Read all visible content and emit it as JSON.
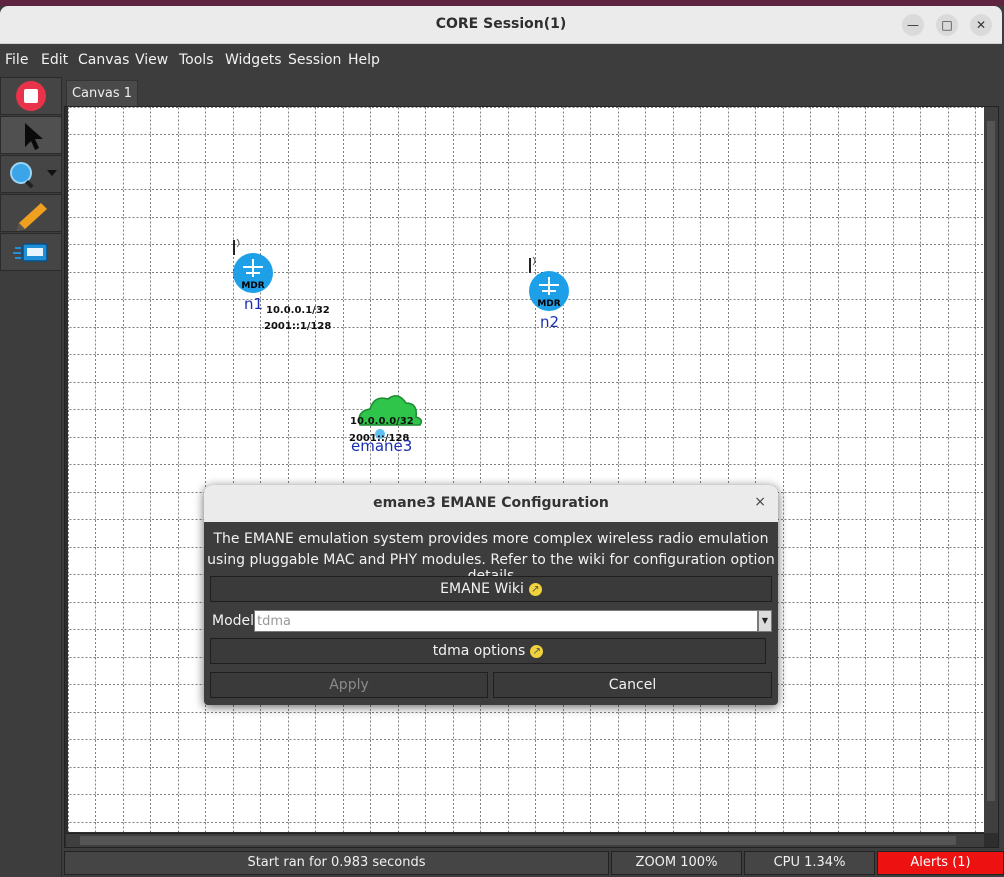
{
  "window": {
    "title": "CORE Session(1)",
    "minimize": "—",
    "maximize": "□",
    "close": "✕"
  },
  "menu": [
    "File",
    "Edit",
    "Canvas",
    "View",
    "Tools",
    "Widgets",
    "Session",
    "Help"
  ],
  "toolbar": {
    "tools": [
      {
        "name": "stop-session-icon"
      },
      {
        "name": "select-pointer-icon"
      },
      {
        "name": "zoom-magnifier-icon"
      },
      {
        "name": "pencil-annotation-icon"
      },
      {
        "name": "run-tool-icon"
      }
    ]
  },
  "canvas": {
    "tab": "Canvas 1"
  },
  "nodes": [
    {
      "label": "n1",
      "type": "MDR",
      "ip4": "10.0.0.1/32",
      "ip6": "2001::1/128"
    },
    {
      "label": "n2",
      "type": "MDR"
    },
    {
      "label": "emane3",
      "ip4": "10.0.0.0/32",
      "ip6": "2001::/128"
    }
  ],
  "dialog": {
    "title": "emane3 EMANE Configuration",
    "close": "×",
    "line1": "The EMANE emulation system provides more complex wireless radio emulation",
    "line2": "using pluggable MAC and PHY modules. Refer to the wiki for configuration option details",
    "wiki_button": "EMANE Wiki",
    "model_label": "Model",
    "model_value": "tdma",
    "options_button": "tdma options",
    "apply_button": "Apply",
    "cancel_button": "Cancel"
  },
  "status": {
    "message": "Start ran for 0.983 seconds",
    "zoom": "ZOOM 100%",
    "cpu": "CPU 1.34%",
    "alerts": "Alerts (1)"
  },
  "colors": {
    "alert": "#ee1111",
    "node_label": "#1a2fb0",
    "router": "#1ea0e8",
    "cloud": "#2fc44a"
  }
}
